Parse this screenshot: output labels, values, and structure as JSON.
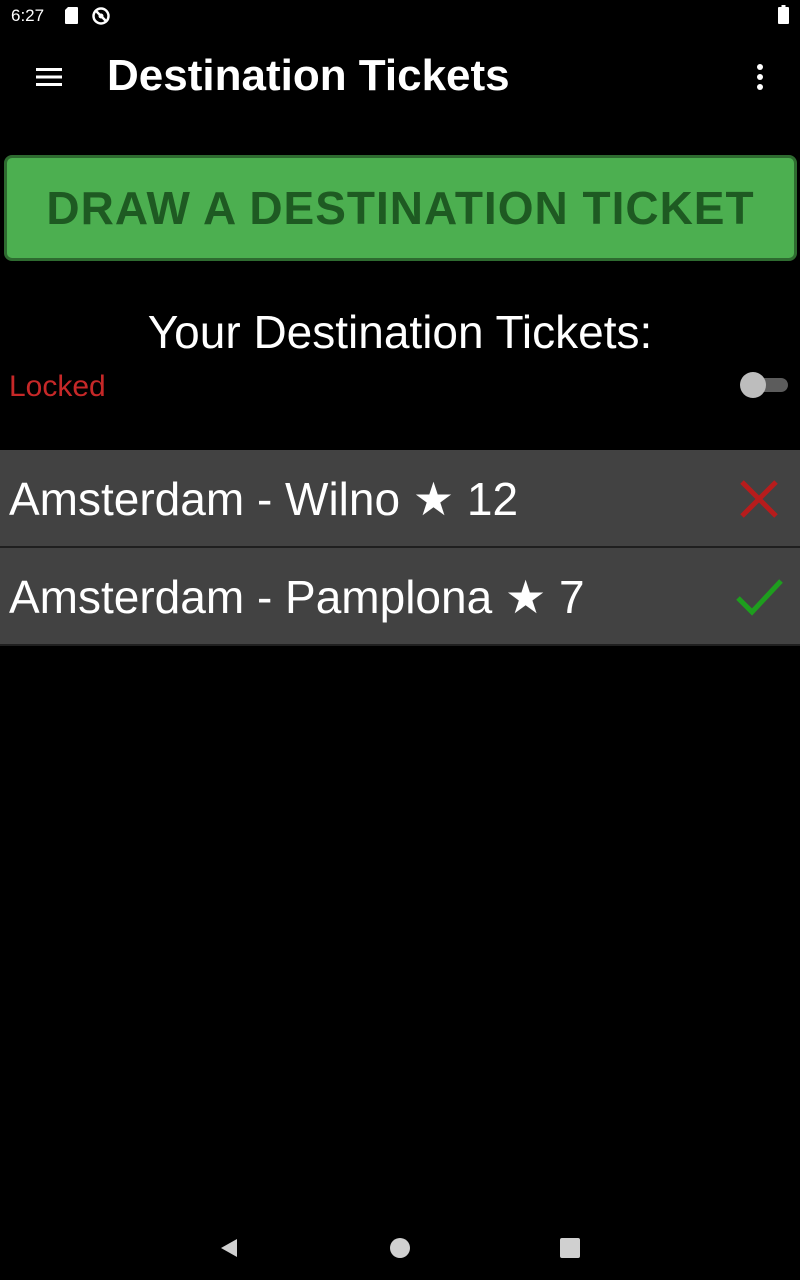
{
  "status_bar": {
    "time": "6:27",
    "icons": [
      "sd-card-icon",
      "sync-icon",
      "battery-icon"
    ]
  },
  "app_bar": {
    "title": "Destination Tickets",
    "icons": [
      "menu-icon",
      "overflow-menu-icon"
    ]
  },
  "draw_button": {
    "label": "DRAW A DESTINATION TICKET"
  },
  "section": {
    "title": "Your Destination Tickets:",
    "lock_label": "Locked",
    "lock_toggle_on": false
  },
  "tickets": [
    {
      "label": "Amsterdam - Wilno ★ 12",
      "status": "incomplete",
      "status_icon": "cross-icon"
    },
    {
      "label": "Amsterdam - Pamplona ★ 7",
      "status": "complete",
      "status_icon": "check-icon"
    }
  ],
  "colors": {
    "button_bg": "#4caf50",
    "button_text": "#1e5a22",
    "locked_text": "#c62828",
    "row_bg": "#424242",
    "cross": "#b71c1c",
    "check": "#1e9e1e"
  },
  "nav_bar": {
    "icons": [
      "back-icon",
      "home-icon",
      "recents-icon"
    ]
  }
}
